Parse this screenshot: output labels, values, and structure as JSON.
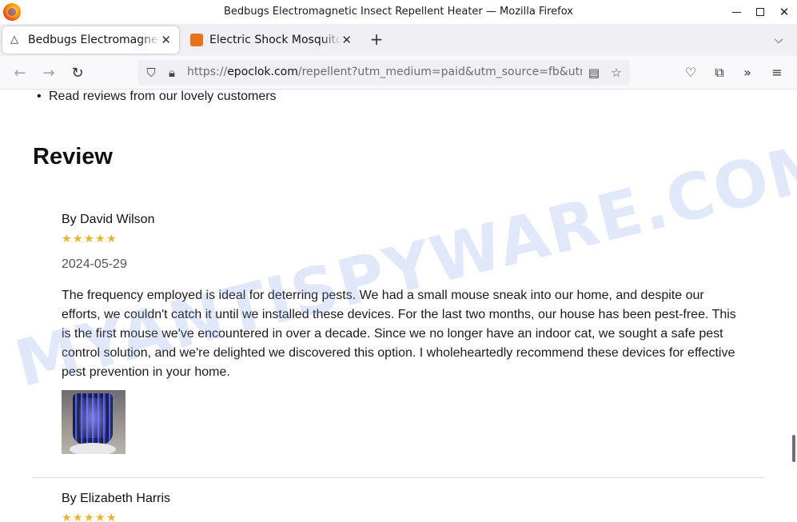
{
  "window": {
    "title": "Bedbugs Electromagnetic Insect Repellent Heater — Mozilla Firefox"
  },
  "tabs": [
    {
      "label": "Bedbugs Electromagnetic Insect Repellent Heater",
      "active": true,
      "icon": "warning-triangle-icon"
    },
    {
      "label": "Electric Shock Mosquito Killer",
      "active": false,
      "icon": "site-favicon"
    }
  ],
  "urlbar": {
    "prefix": "https://",
    "domain": "epoclok.com",
    "path": "/repellent?utm_medium=paid&utm_source=fb&utm_id"
  },
  "page": {
    "bullet": "Read reviews from our lovely customers",
    "heading": "Review",
    "reviews": [
      {
        "author": "By David Wilson",
        "rating": 5,
        "date": "2024-05-29",
        "body": "The frequency employed is ideal for deterring pests. We had a small mouse sneak into our home, and despite our efforts, we couldn't catch it until we installed these devices. For the last two months, our house has been pest-free. This is the first mouse we've encountered in over a decade. Since we no longer have an indoor cat, we sought a safe pest control solution, and we're delighted we discovered this option. I wholeheartedly recommend these devices for effective pest prevention in your home."
      },
      {
        "author": "By Elizabeth Harris",
        "rating": 5
      }
    ]
  },
  "watermark": "MYANTISPYWARE.COM",
  "colors": {
    "star": "#f2b320",
    "tabstrip": "#f0f0f4",
    "urlbar": "#f0f0f4"
  }
}
